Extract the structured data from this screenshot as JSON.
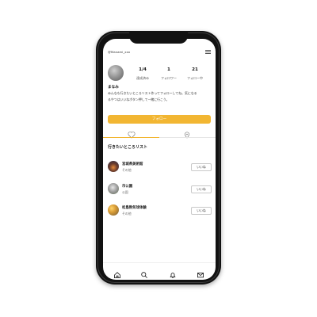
{
  "header": {
    "username": "@Manami_xxx",
    "menu_icon": "hamburger-menu-icon"
  },
  "profile": {
    "stats": [
      {
        "value": "1/4",
        "label": "達成済み"
      },
      {
        "value": "1",
        "label": "フォロワー"
      },
      {
        "value": "21",
        "label": "フォロー中"
      }
    ],
    "name": "まなみ",
    "bio_line1": "みんなも行きたいところリスト作ってフォローしてね。気になる",
    "bio_line2": "るやつはいいねボタン押して一緒に行こう。",
    "follow_label": "フォロー"
  },
  "tabs": {
    "left_icon": "heart-icon",
    "right_icon": "location-pin-icon"
  },
  "list": {
    "title": "行きたいところリスト",
    "items": [
      {
        "title": "宮城県美術館",
        "category": "その他",
        "like": "いいね"
      },
      {
        "title": "市公園",
        "category": "公園",
        "like": "いいね"
      },
      {
        "title": "松島熱気球体験",
        "category": "その他",
        "like": "いいね"
      }
    ]
  },
  "bottom_nav": {
    "items": [
      {
        "icon": "home-icon"
      },
      {
        "icon": "search-icon"
      },
      {
        "icon": "bell-icon"
      },
      {
        "icon": "mail-icon"
      }
    ]
  },
  "colors": {
    "accent": "#f2b632",
    "phone_frame": "#121212"
  }
}
